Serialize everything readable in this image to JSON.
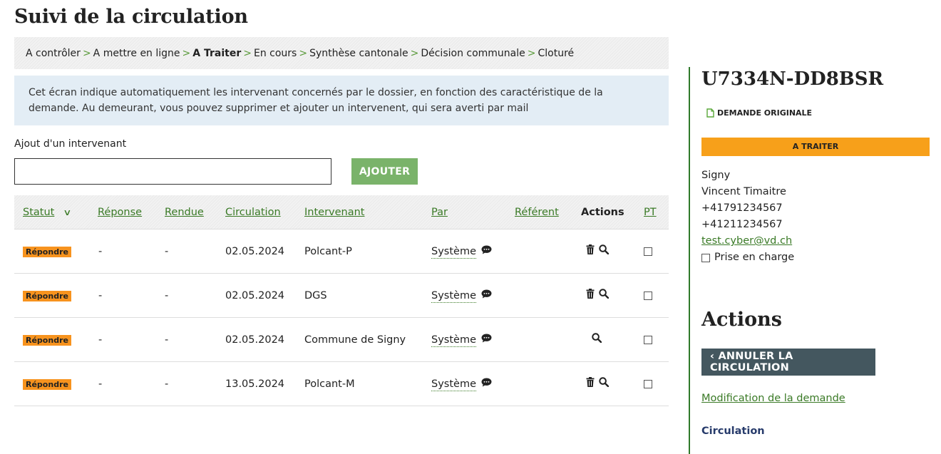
{
  "page_title": "Suivi de la circulation",
  "breadcrumb": [
    {
      "label": "A contrôler",
      "current": false
    },
    {
      "label": "A mettre en ligne",
      "current": false
    },
    {
      "label": "A Traiter",
      "current": true
    },
    {
      "label": "En cours",
      "current": false
    },
    {
      "label": "Synthèse cantonale",
      "current": false
    },
    {
      "label": "Décision communale",
      "current": false
    },
    {
      "label": "Cloturé",
      "current": false
    }
  ],
  "breadcrumb_separator": ">",
  "info_text": "Cet écran indique automatiquement les intervenant concernés par le dossier, en fonction des caractéristique de la demande. Au demeurant, vous pouvez supprimer et ajouter un intervenent, qui sera averti par mail",
  "add_form": {
    "label": "Ajout d'un intervenant",
    "value": "",
    "placeholder": "",
    "button_label": "AJOUTER"
  },
  "table": {
    "headers": {
      "statut": "Statut",
      "reponse": "Réponse",
      "rendue": "Rendue",
      "circulation": "Circulation",
      "intervenant": "Intervenant",
      "par": "Par",
      "referent": "Référent",
      "actions": "Actions",
      "pt": "PT"
    },
    "rows": [
      {
        "statut": "Répondre",
        "reponse": "-",
        "rendue": "-",
        "circulation": "02.05.2024",
        "intervenant": "Polcant-P",
        "par": "Système",
        "referent": "",
        "can_delete": true,
        "pt_checked": false
      },
      {
        "statut": "Répondre",
        "reponse": "-",
        "rendue": "-",
        "circulation": "02.05.2024",
        "intervenant": "DGS",
        "par": "Système",
        "referent": "",
        "can_delete": true,
        "pt_checked": false
      },
      {
        "statut": "Répondre",
        "reponse": "-",
        "rendue": "-",
        "circulation": "02.05.2024",
        "intervenant": "Commune de Signy",
        "par": "Système",
        "referent": "",
        "can_delete": false,
        "pt_checked": false
      },
      {
        "statut": "Répondre",
        "reponse": "-",
        "rendue": "-",
        "circulation": "13.05.2024",
        "intervenant": "Polcant-M",
        "par": "Système",
        "referent": "",
        "can_delete": true,
        "pt_checked": false
      }
    ]
  },
  "sidebar": {
    "dossier_id": "U7334N-DD8BSR",
    "original_link": "DEMANDE ORIGINALE",
    "status": "A TRAITER",
    "contact": {
      "commune": "Signy",
      "name": "Vincent Timaitre",
      "phone1": "+41791234567",
      "phone2": "+41211234567",
      "email": "test.cyber@vd.ch",
      "prise_en_charge_label": "Prise en charge",
      "prise_en_charge_checked": false
    },
    "actions_title": "Actions",
    "cancel_button": "ANNULER LA CIRCULATION",
    "modification_link": "Modification de la demande",
    "circulation_link": "Circulation"
  },
  "colors": {
    "accent_green": "#3a7a26",
    "badge_orange": "#f7931e",
    "status_orange": "#f7a01a",
    "button_green": "#7ab36a",
    "dark_button": "#44575f",
    "info_bg": "#e3edf5"
  },
  "icons": {
    "sort": "chevron-down-icon",
    "comment": "comment-bubble-icon",
    "delete": "trash-icon",
    "view": "magnifier-icon",
    "document": "document-icon",
    "back": "chevron-left-icon"
  }
}
